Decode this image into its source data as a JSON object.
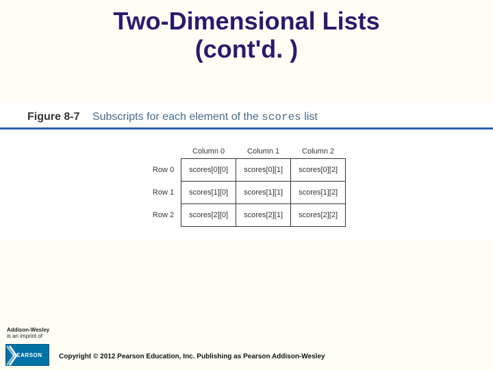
{
  "title_line1": "Two-Dimensional Lists",
  "title_line2": "(cont'd. )",
  "figure": {
    "number": "Figure 8-7",
    "caption_prefix": "Subscripts for each element of the ",
    "caption_code": "scores",
    "caption_suffix": " list"
  },
  "col_headers": [
    "Column 0",
    "Column 1",
    "Column 2"
  ],
  "row_headers": [
    "Row 0",
    "Row 1",
    "Row 2"
  ],
  "cells": [
    [
      "scores[0][0]",
      "scores[0][1]",
      "scores[0][2]"
    ],
    [
      "scores[1][0]",
      "scores[1][1]",
      "scores[1][2]"
    ],
    [
      "scores[2][0]",
      "scores[2][1]",
      "scores[2][2]"
    ]
  ],
  "imprint_line1": "Addison-Wesley",
  "imprint_line2": "is an imprint of",
  "logo_text": "PEARSON",
  "copyright": "Copyright © 2012 Pearson Education, Inc. Publishing as Pearson Addison-Wesley"
}
